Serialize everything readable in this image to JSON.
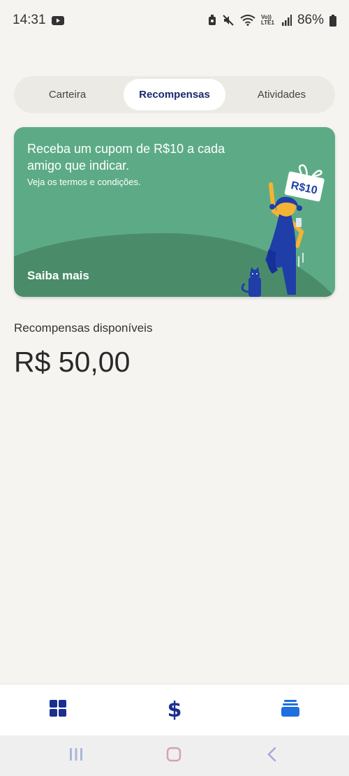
{
  "status": {
    "time": "14:31",
    "battery": "86%",
    "network": "Vo)) LTE1"
  },
  "tabs": [
    {
      "label": "Carteira",
      "active": false
    },
    {
      "label": "Recompensas",
      "active": true
    },
    {
      "label": "Atividades",
      "active": false
    }
  ],
  "promo": {
    "title": "Receba um cupom de R$10 a cada amigo que indicar.",
    "subtitle": "Veja os termos e condições.",
    "link": "Saiba mais",
    "ticket_text": "R$10",
    "colors": {
      "background": "#5dab86",
      "hill": "#4a8c6a",
      "figure": "#1f3ea8",
      "accent": "#f5b335"
    }
  },
  "rewards": {
    "label": "Recompensas disponíveis",
    "amount": "R$ 50,00"
  },
  "bottom_nav": [
    {
      "icon": "grid-icon",
      "color": "#1b2f8f"
    },
    {
      "icon": "dollar-icon",
      "color": "#1b2f8f"
    },
    {
      "icon": "cards-stack-icon",
      "color": "#1e6fe0"
    }
  ],
  "system_nav": [
    {
      "icon": "recent-apps-icon"
    },
    {
      "icon": "home-icon"
    },
    {
      "icon": "back-icon"
    }
  ]
}
